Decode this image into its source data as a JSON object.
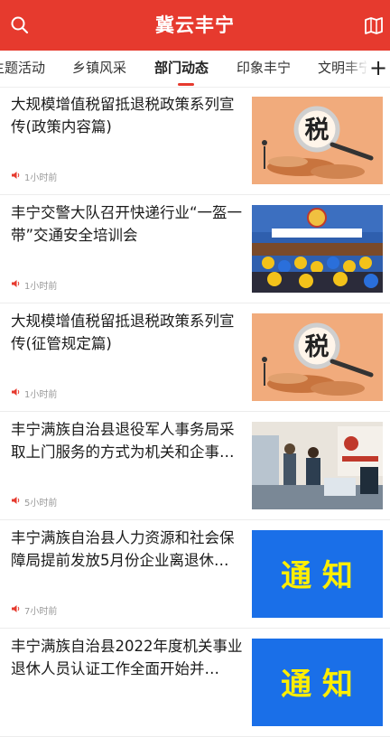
{
  "header": {
    "title": "冀云丰宁"
  },
  "tabs": [
    {
      "label": "主题活动"
    },
    {
      "label": "乡镇风采"
    },
    {
      "label": "部门动态"
    },
    {
      "label": "印象丰宁"
    },
    {
      "label": "文明丰宁"
    }
  ],
  "tab_add_label": "+",
  "feed": [
    {
      "title": "大规模增值税留抵退税政策系列宣传(政策内容篇)",
      "time": "1小时前",
      "thumb": "tax-graphic",
      "thumb_text": "税"
    },
    {
      "title": "丰宁交警大队召开快递行业“一盔一带”交通安全培训会",
      "time": "1小时前",
      "thumb": "meeting-photo"
    },
    {
      "title": "大规模增值税留抵退税政策系列宣传(征管规定篇)",
      "time": "1小时前",
      "thumb": "tax-graphic",
      "thumb_text": "税"
    },
    {
      "title": "丰宁满族自治县退役军人事务局采取上门服务的方式为机关和企事…",
      "time": "5小时前",
      "thumb": "office-photo"
    },
    {
      "title": "丰宁满族自治县人力资源和社会保障局提前发放5月份企业离退休…",
      "time": "7小时前",
      "thumb": "notice-graphic",
      "thumb_text": "通 知"
    },
    {
      "title": "丰宁满族自治县2022年度机关事业退休人员认证工作全面开始并…",
      "time": "",
      "thumb": "notice-graphic",
      "thumb_text": "通 知"
    }
  ],
  "colors": {
    "brand": "#e63a2e",
    "notice_bg": "#1a6fe8",
    "notice_text": "#ffee00",
    "meta": "#999999"
  }
}
